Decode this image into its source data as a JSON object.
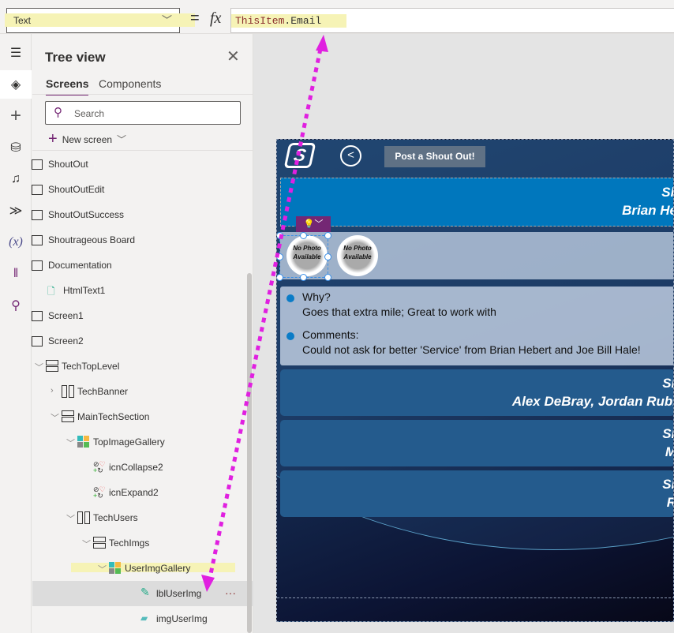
{
  "formula_bar": {
    "property": "Text",
    "equals": "=",
    "fx": "fx",
    "formula_object": "ThisItem",
    "formula_field": ".Email"
  },
  "rail": {
    "icons": [
      "hamburger-icon",
      "layers-icon",
      "plus-icon",
      "database-icon",
      "media-icon",
      "power-automate-icon",
      "variables-icon",
      "tools-icon",
      "search-icon"
    ],
    "variables_label": "(x)"
  },
  "tree": {
    "title": "Tree view",
    "tabs": [
      {
        "label": "Screens",
        "active": true
      },
      {
        "label": "Components"
      }
    ],
    "search_placeholder": "Search",
    "new_screen": "New screen",
    "items": [
      {
        "label": "ShoutOut",
        "type": "screen",
        "level": 0
      },
      {
        "label": "ShoutOutEdit",
        "type": "screen",
        "level": 0
      },
      {
        "label": "ShoutOutSuccess",
        "type": "screen",
        "level": 0
      },
      {
        "label": "Shoutrageous Board",
        "type": "screen",
        "level": 0
      },
      {
        "label": "Documentation",
        "type": "screen",
        "level": 0
      },
      {
        "label": "HtmlText1",
        "type": "html",
        "level": 1
      },
      {
        "label": "Screen1",
        "type": "screen",
        "level": 0
      },
      {
        "label": "Screen2",
        "type": "screen",
        "level": 0
      },
      {
        "label": "TechTopLevel",
        "type": "vcontainer",
        "level": 1,
        "expanded": true
      },
      {
        "label": "TechBanner",
        "type": "hcontainer",
        "level": 2,
        "expanded": false
      },
      {
        "label": "MainTechSection",
        "type": "vcontainer",
        "level": 2,
        "expanded": true
      },
      {
        "label": "TopImageGallery",
        "type": "gallery",
        "level": 3,
        "expanded": true
      },
      {
        "label": "icnCollapse2",
        "type": "icon",
        "level": 4
      },
      {
        "label": "icnExpand2",
        "type": "icon",
        "level": 4
      },
      {
        "label": "TechUsers",
        "type": "hcontainer",
        "level": 3,
        "expanded": true
      },
      {
        "label": "TechImgs",
        "type": "vcontainer",
        "level": 4,
        "expanded": true
      },
      {
        "label": "UserImgGallery",
        "type": "gallery",
        "level": 5,
        "expanded": true,
        "highlighted": true
      },
      {
        "label": "lblUserImg",
        "type": "label",
        "level": 6,
        "selected": true
      },
      {
        "label": "imgUserImg",
        "type": "image",
        "level": 6
      }
    ],
    "more": "···"
  },
  "app": {
    "logo": "S",
    "post_button": "Post a Shout Out!",
    "banner": {
      "line1": "Sh",
      "line2": "Brian He"
    },
    "photos": [
      "No Photo Available",
      "No Photo Available"
    ],
    "details": {
      "why_label": "Why?",
      "why_value": "Goes that extra mile; Great to work with",
      "comments_label": "Comments:",
      "comments_value": "Could not ask for better 'Service' from Brian Hebert and Joe Bill Hale!"
    },
    "cards": [
      {
        "line1": "Sh",
        "line2": "Alex DeBray, Jordan Rubi"
      },
      {
        "line1": "Sh",
        "line2": "M"
      },
      {
        "line1": "Sh",
        "line2": "R"
      }
    ]
  },
  "colors": {
    "accent": "#742774",
    "banner": "#0077bd",
    "annotation": "#e020e0",
    "highlight": "#f6f3b6"
  }
}
